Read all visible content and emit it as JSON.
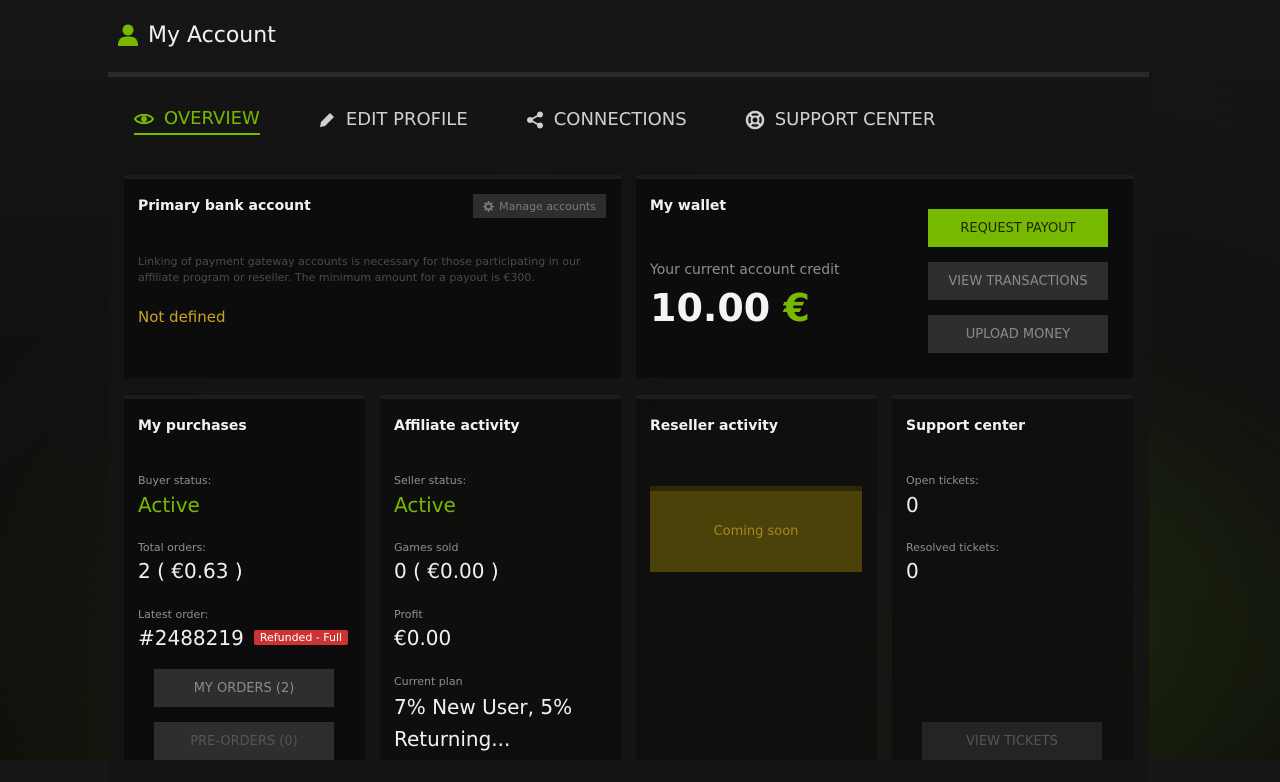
{
  "header": {
    "title": "My Account",
    "icon": "user-icon"
  },
  "tabs": [
    {
      "label": "OVERVIEW",
      "icon": "eye-icon",
      "active": true
    },
    {
      "label": "EDIT PROFILE",
      "icon": "pencil-icon"
    },
    {
      "label": "CONNECTIONS",
      "icon": "share-icon"
    },
    {
      "label": "SUPPORT CENTER",
      "icon": "lifebuoy-icon"
    }
  ],
  "bank": {
    "title": "Primary bank account",
    "manage_label": "Manage accounts",
    "description": "Linking of payment gateway accounts is necessary for those participating in our affiliate program or reseller. The minimum amount for a payout is €300.",
    "status": "Not defined"
  },
  "wallet": {
    "title": "My wallet",
    "credit_label": "Your current account credit",
    "amount": "10.00",
    "currency": "€",
    "request_payout": "REQUEST PAYOUT",
    "view_transactions": "VIEW TRANSACTIONS",
    "upload_money": "UPLOAD MONEY"
  },
  "purchases": {
    "title": "My purchases",
    "buyer_status_label": "Buyer status:",
    "buyer_status": "Active",
    "total_orders_label": "Total orders:",
    "total_orders": "2 ( €0.63 )",
    "latest_order_label": "Latest order:",
    "latest_order": "#2488219",
    "latest_order_badge": "Refunded - Full",
    "my_orders": "MY ORDERS (2)",
    "pre_orders": "PRE-ORDERS (0)"
  },
  "affiliate": {
    "title": "Affiliate activity",
    "seller_status_label": "Seller status:",
    "seller_status": "Active",
    "games_sold_label": "Games sold",
    "games_sold": "0 ( €0.00 )",
    "profit_label": "Profit",
    "profit": "€0.00",
    "plan_label": "Current plan",
    "plan": "7% New User, 5% Returning..."
  },
  "reseller": {
    "title": "Reseller activity",
    "coming_soon": "Coming soon"
  },
  "support": {
    "title": "Support center",
    "open_label": "Open tickets:",
    "open": "0",
    "resolved_label": "Resolved tickets:",
    "resolved": "0",
    "view_tickets": "VIEW TICKETS"
  },
  "colors": {
    "accent": "#76b900",
    "warning": "#c9a227",
    "danger": "#cc3333"
  }
}
